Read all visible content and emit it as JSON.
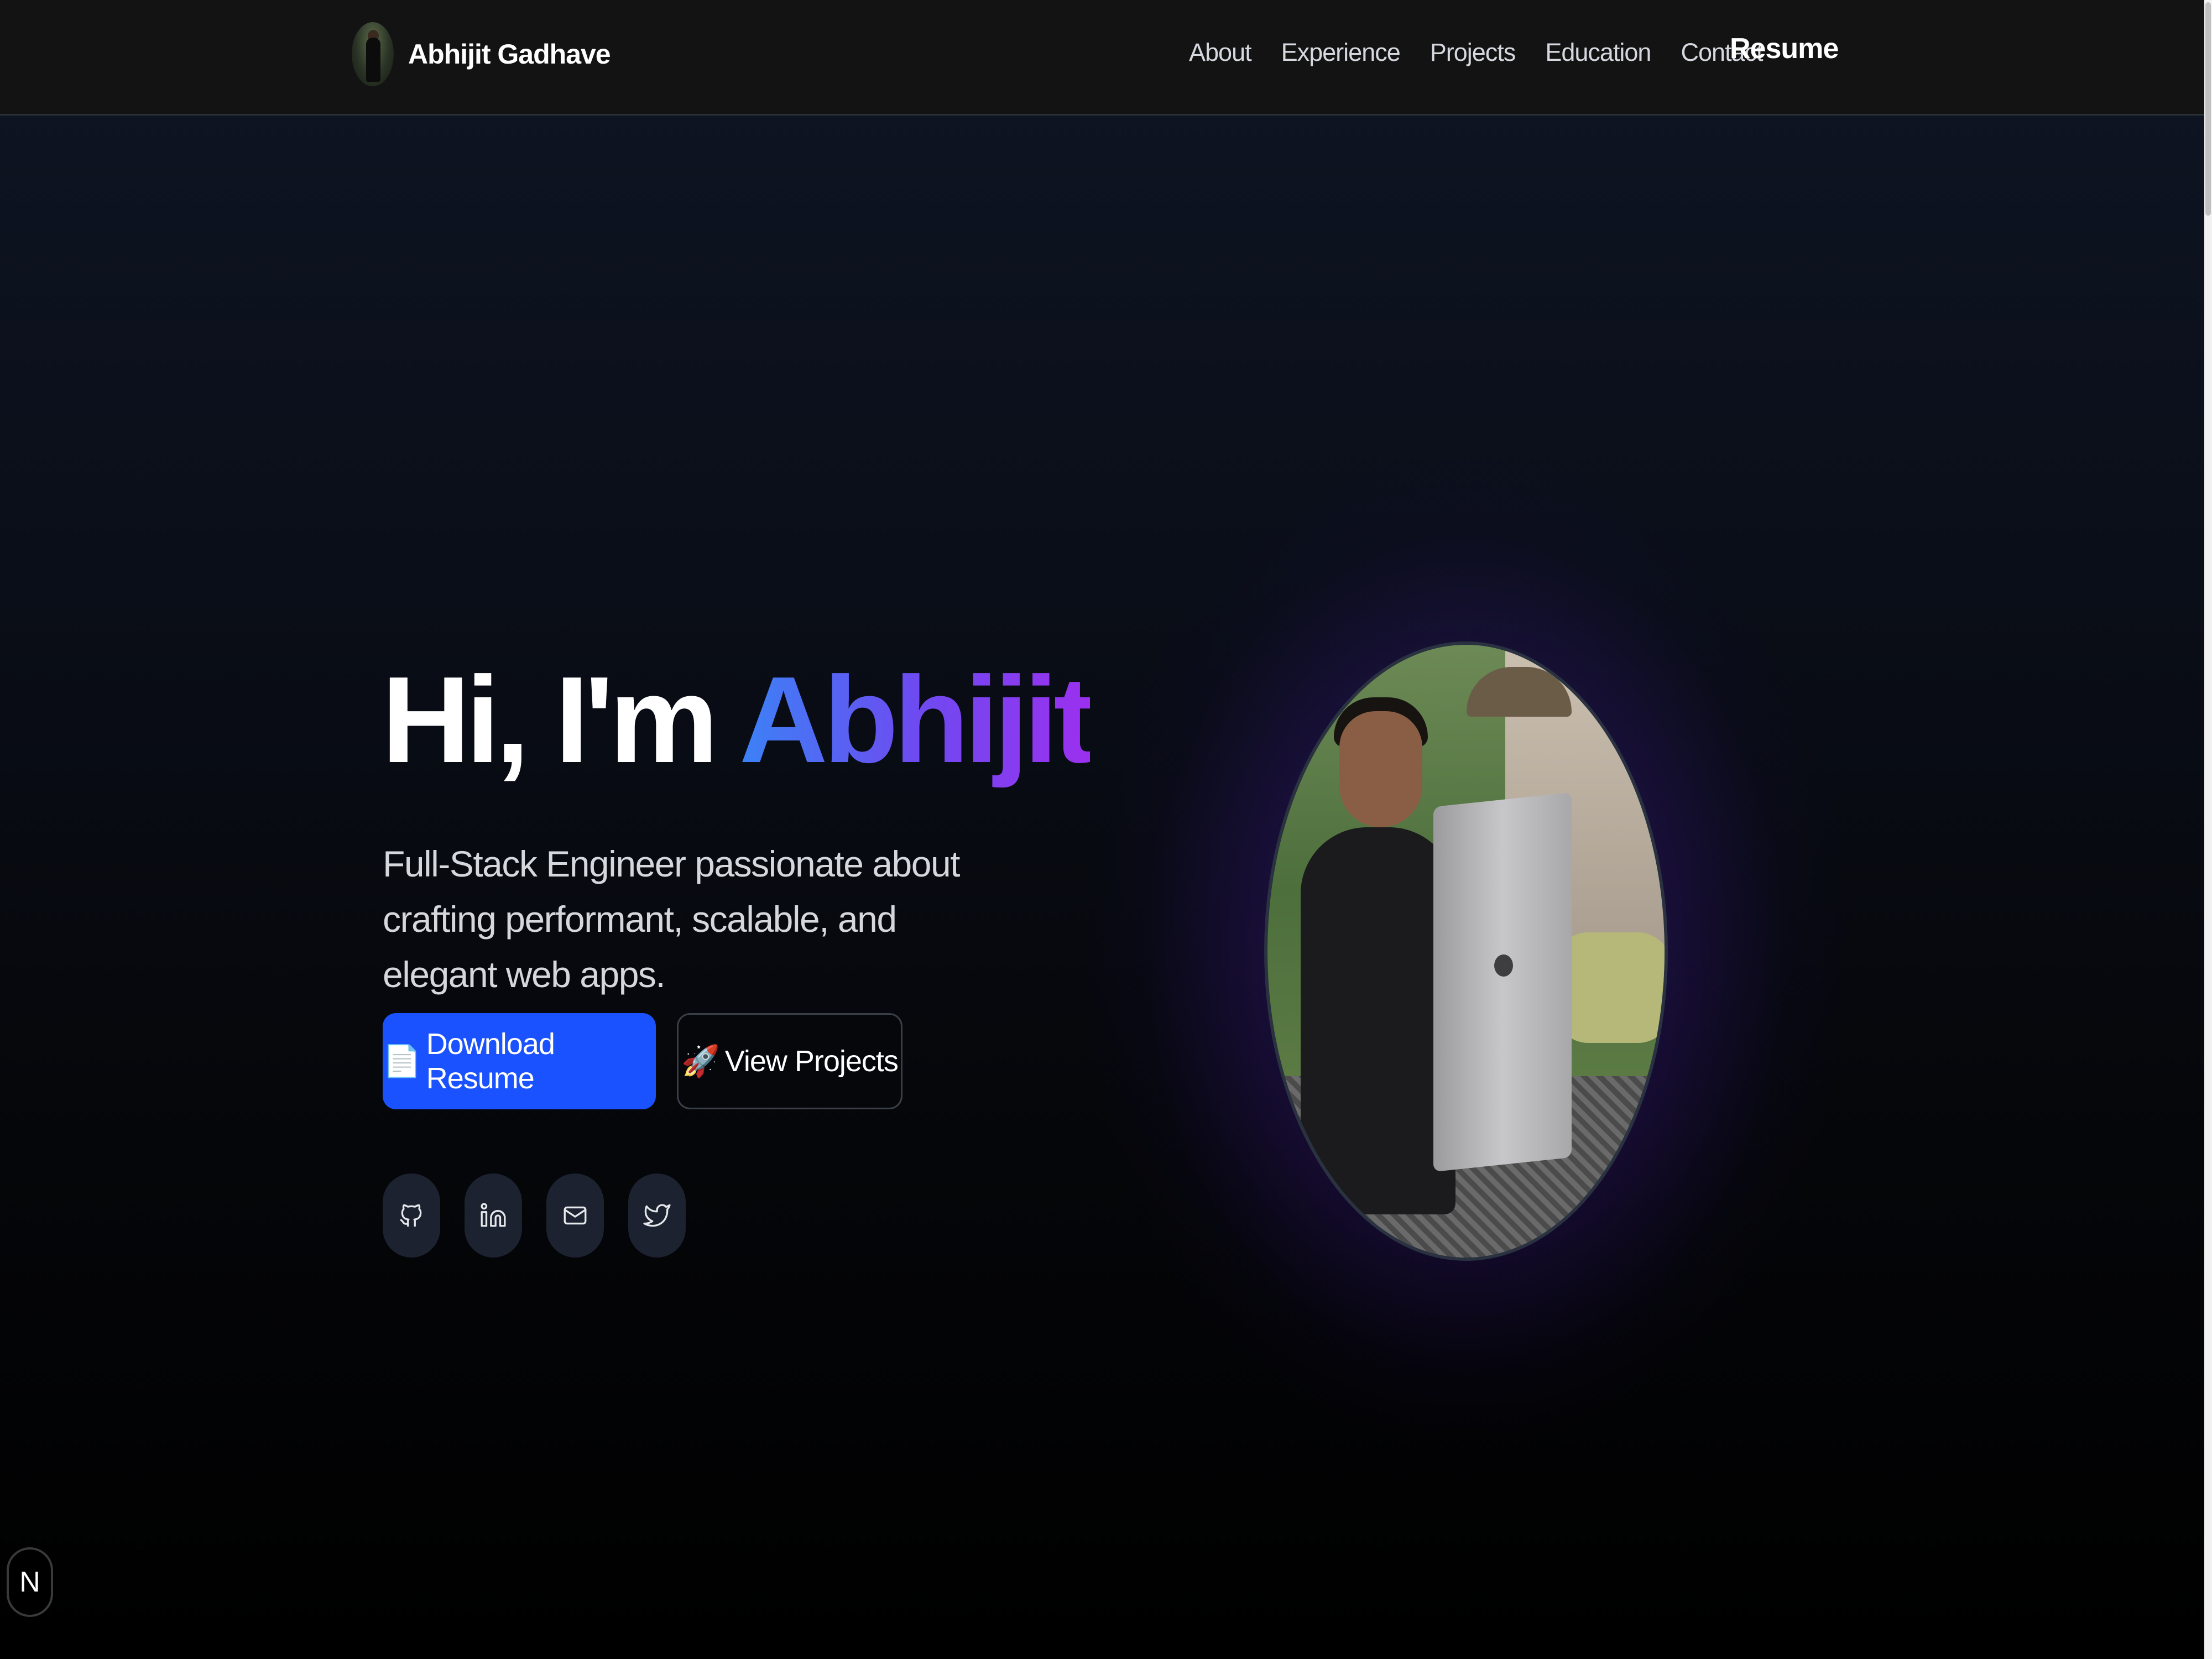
{
  "navbar": {
    "brand_name": "Abhijit Gadhave",
    "links": [
      {
        "label": "About"
      },
      {
        "label": "Experience"
      },
      {
        "label": "Projects"
      },
      {
        "label": "Education"
      },
      {
        "label": "Contact"
      }
    ],
    "resume_label": "Resume"
  },
  "hero": {
    "greeting": "Hi, I'm ",
    "name": "Abhijit",
    "subtitle": "Full-Stack Engineer passionate about crafting performant, scalable, and elegant web apps.",
    "download_icon": "📄",
    "download_label": "Download Resume",
    "projects_icon": "🚀",
    "projects_label": "View Projects",
    "socials": [
      {
        "icon": "github-icon"
      },
      {
        "icon": "linkedin-icon"
      },
      {
        "icon": "mail-icon"
      },
      {
        "icon": "twitter-icon"
      }
    ]
  },
  "badge": {
    "label": "N"
  },
  "colors": {
    "accent_blue": "#1a52ff",
    "gradient_start": "#3b82f6",
    "gradient_end": "#9b30ef",
    "glow": "#5a28be"
  }
}
